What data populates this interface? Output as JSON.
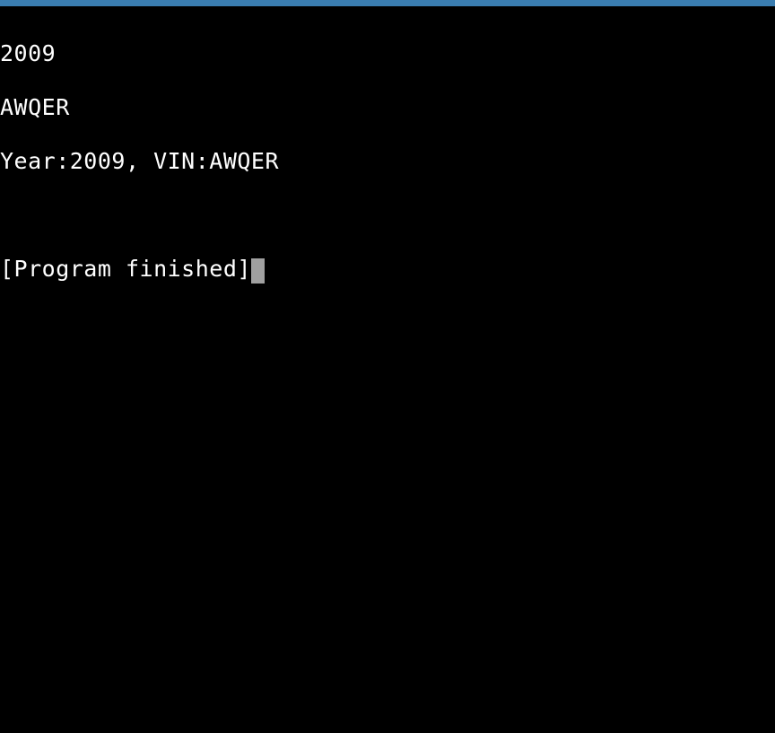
{
  "terminal": {
    "lines": {
      "line1": "2009",
      "line2": "AWQER",
      "line3": "Year:2009, VIN:AWQER",
      "line4": "",
      "line5": "[Program finished]"
    }
  }
}
